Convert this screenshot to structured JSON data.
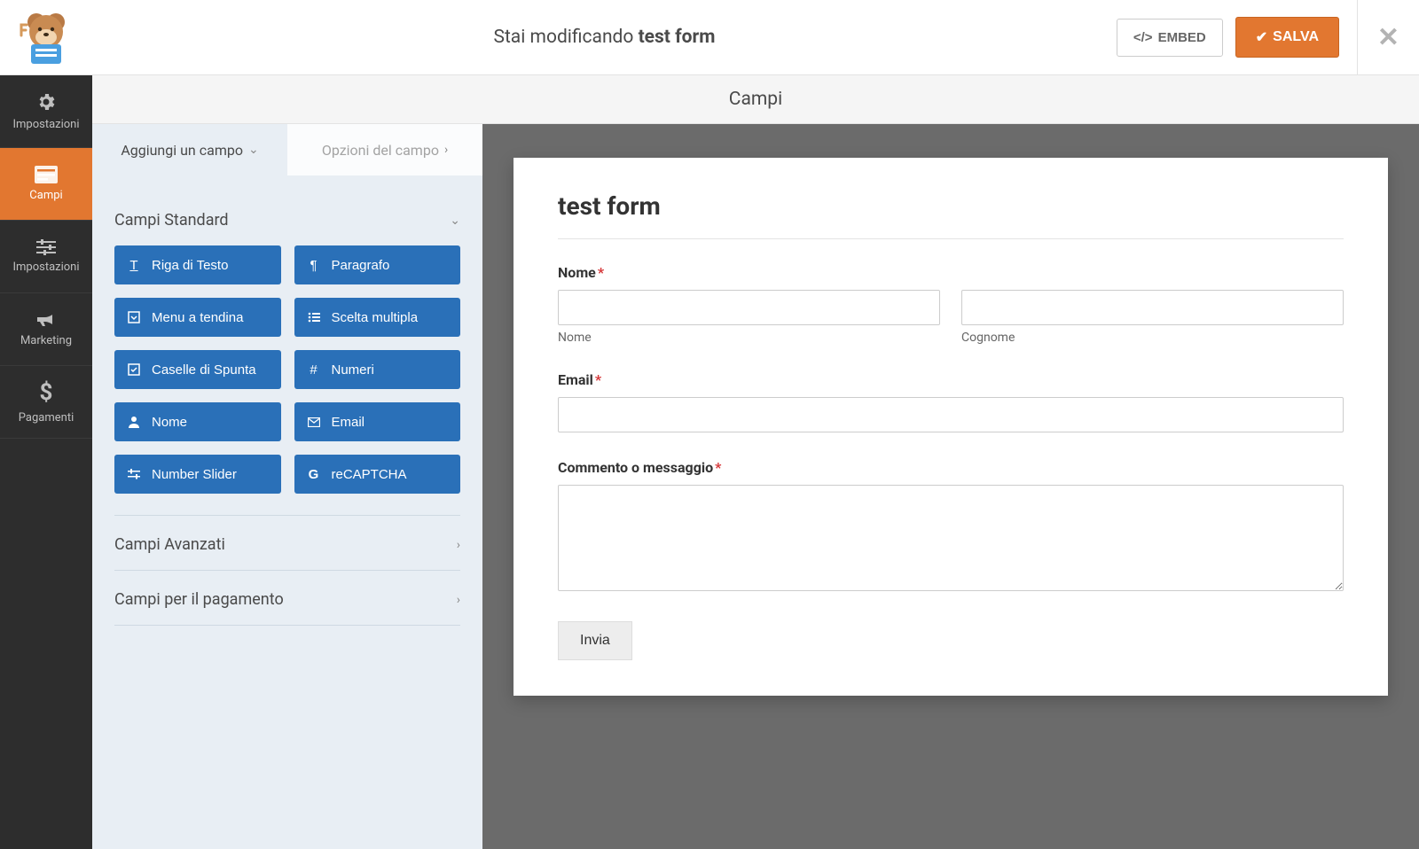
{
  "topbar": {
    "editing_prefix": "Stai modificando ",
    "form_name": "test form",
    "embed_label": "EMBED",
    "save_label": "SALVA"
  },
  "leftnav": {
    "items": [
      {
        "label": "Impostazioni",
        "icon": "gear"
      },
      {
        "label": "Campi",
        "icon": "form",
        "active": true
      },
      {
        "label": "Impostazioni",
        "icon": "sliders"
      },
      {
        "label": "Marketing",
        "icon": "bullhorn"
      },
      {
        "label": "Pagamenti",
        "icon": "dollar"
      }
    ]
  },
  "section_header": "Campi",
  "panel": {
    "tabs": {
      "add": "Aggiungi un campo",
      "opts": "Opzioni del campo"
    },
    "groups": {
      "standard": "Campi Standard",
      "advanced": "Campi Avanzati",
      "payment": "Campi per il pagamento"
    },
    "fields": {
      "text": "Riga di Testo",
      "paragraph": "Paragrafo",
      "dropdown": "Menu a tendina",
      "multichoice": "Scelta multipla",
      "checkbox": "Caselle di Spunta",
      "numbers": "Numeri",
      "name": "Nome",
      "email": "Email",
      "slider": "Number Slider",
      "recaptcha": "reCAPTCHA"
    }
  },
  "preview": {
    "title": "test form",
    "name_label": "Nome",
    "first_sub": "Nome",
    "last_sub": "Cognome",
    "email_label": "Email",
    "message_label": "Commento o messaggio",
    "submit": "Invia"
  }
}
